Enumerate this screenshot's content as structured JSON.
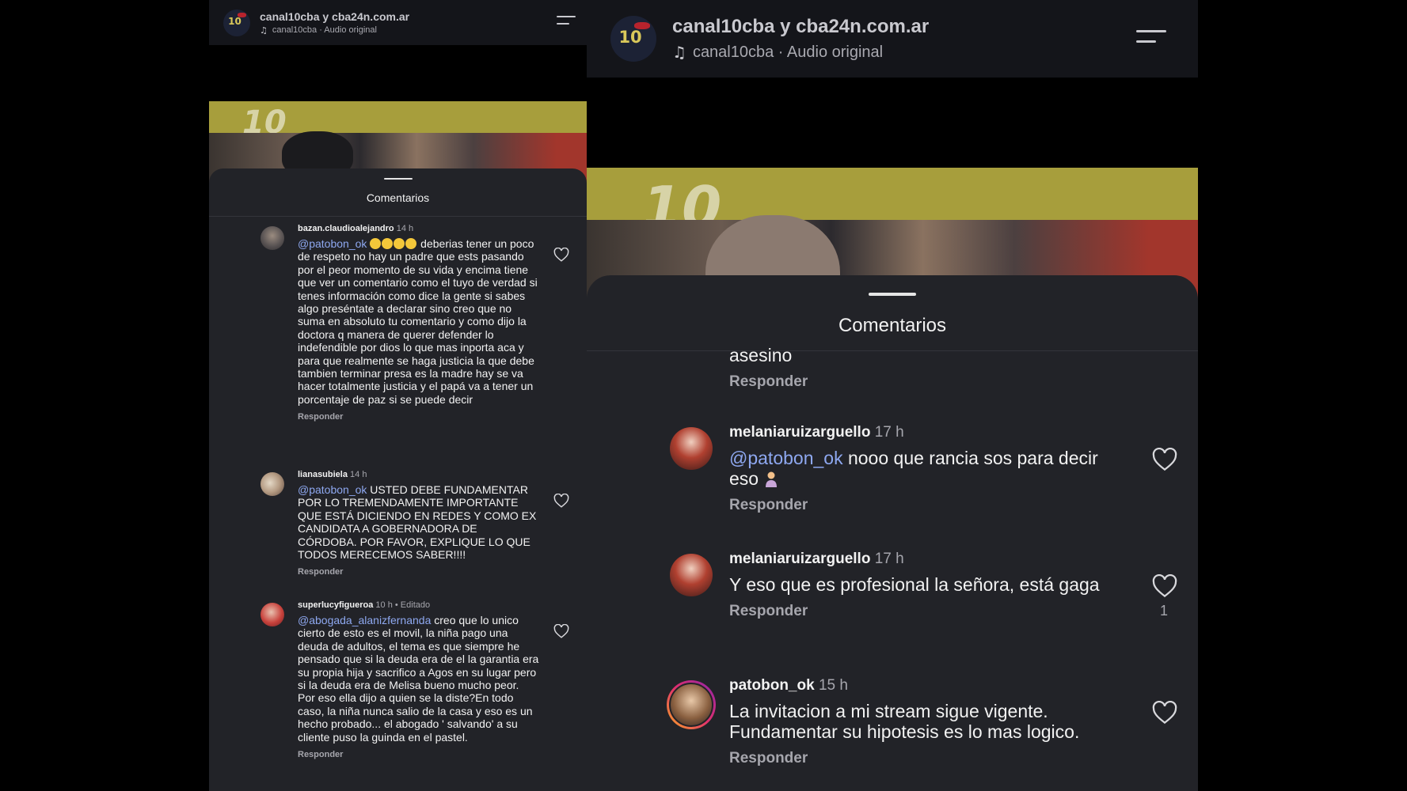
{
  "reel": {
    "account_title": "canal10cba y cba24n.com.ar",
    "audio": "canal10cba · Audio original",
    "logo_text": "10",
    "video_overlay_text": "10"
  },
  "sheet": {
    "title": "Comentarios"
  },
  "left_comments": [
    {
      "username": "bazan.claudioalejandro",
      "time": "14 h",
      "mention": "@patobon_ok",
      "text": " deberias tener un poco de respeto no hay un padre que ests pasando por el peor momento de su vida y encima tiene que ver  un comentario como el tuyo de verdad si tenes información como dice la gente si sabes algo preséntate a declarar sino creo que no suma en absoluto tu comentario y como dijo la doctora q manera de querer defender lo indefendible por dios lo que mas inporta aca y para que realmente se haga justicia la que debe tambien terminar presa es la madre hay se va hacer totalmente justicia y el papá va a tener un porcentaje de paz si se puede decir",
      "reply": "Responder"
    },
    {
      "username": "lianasubiela",
      "time": "14 h",
      "mention": "@patobon_ok",
      "text": " USTED DEBE FUNDAMENTAR POR LO TREMENDAMENTE IMPORTANTE QUE ESTÁ DICIENDO EN REDES Y COMO EX CANDIDATA A GOBERNADORA DE CÓRDOBA. POR FAVOR, EXPLIQUE LO QUE TODOS MERECEMOS SABER!!!!",
      "reply": "Responder"
    },
    {
      "username": "superlucyfigueroa",
      "time": "10 h • Editado",
      "mention": "@abogada_alanizfernanda",
      "text": "  creo que lo unico cierto de esto es el movil, la niña pago una deuda de adultos, el tema es que siempre he pensado que si la deuda era de el la garantia era su propia hija y  sacrifico a Agos en su lugar  pero si la deuda era de Melisa bueno mucho peor.  Por eso ella dijo a quien se la diste?En todo caso, la niña nunca salio de la casa y eso es un hecho probado... el abogado ' salvando' a su cliente puso la guinda en el pastel.",
      "reply": "Responder"
    }
  ],
  "right_comments": [
    {
      "partial_text": "asesino",
      "reply": "Responder"
    },
    {
      "username": "melaniaruizarguello",
      "time": "17 h",
      "mention": "@patobon_ok",
      "text": " nooo que rancia sos para decir eso",
      "reply": "Responder",
      "likes": ""
    },
    {
      "username": "melaniaruizarguello",
      "time": "17 h",
      "text": "Y eso que es profesional la señora, está gaga",
      "reply": "Responder",
      "likes": "1"
    },
    {
      "username": "patobon_ok",
      "time": "15 h",
      "text": "La invitacion a mi stream sigue vigente. Fundamentar su hipotesis es lo mas logico.",
      "reply": "Responder",
      "likes": ""
    }
  ],
  "colors": {
    "sheet_bg": "#222328",
    "mention": "#8ea8f0",
    "muted": "#a6a6ad",
    "topbar_bg": "#14151a",
    "video_band": "#a79e3c"
  },
  "icons": [
    "menu-icon",
    "music-note-icon",
    "heart-icon",
    "drag-handle"
  ]
}
